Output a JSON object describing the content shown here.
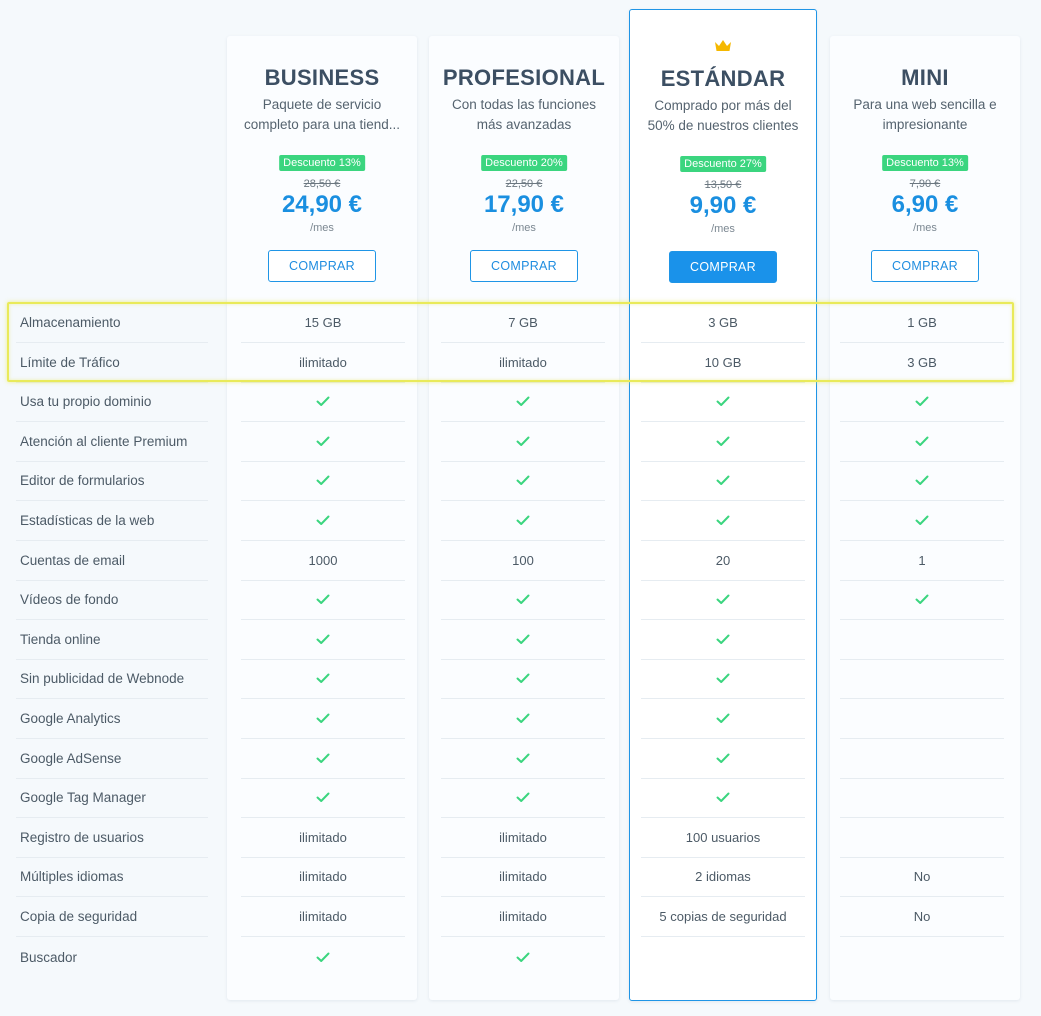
{
  "plans": [
    {
      "name": "BUSINESS",
      "desc": "Paquete de servicio completo para una tiend...",
      "discount": "Descuento 13%",
      "old_price": "28,50 €",
      "price": "24,90 €",
      "period": "/mes",
      "buy_label": "COMPRAR",
      "featured": false
    },
    {
      "name": "PROFESIONAL",
      "desc": "Con todas las funciones más avanzadas",
      "discount": "Descuento 20%",
      "old_price": "22,50 €",
      "price": "17,90 €",
      "period": "/mes",
      "buy_label": "COMPRAR",
      "featured": false
    },
    {
      "name": "ESTÁNDAR",
      "desc": "Comprado por más del 50% de nuestros clientes",
      "discount": "Descuento 27%",
      "old_price": "13,50 €",
      "price": "9,90 €",
      "period": "/mes",
      "buy_label": "COMPRAR",
      "featured": true
    },
    {
      "name": "MINI",
      "desc": "Para una web sencilla e impresionante",
      "discount": "Descuento 13%",
      "old_price": "7,90 €",
      "price": "6,90 €",
      "period": "/mes",
      "buy_label": "COMPRAR",
      "featured": false
    }
  ],
  "features": [
    {
      "label": "Almacenamiento",
      "values": [
        "15 GB",
        "7 GB",
        "3 GB",
        "1 GB"
      ]
    },
    {
      "label": "Límite de Tráfico",
      "values": [
        "ilimitado",
        "ilimitado",
        "10 GB",
        "3 GB"
      ]
    },
    {
      "label": "Usa tu propio dominio",
      "values": [
        "check",
        "check",
        "check",
        "check"
      ]
    },
    {
      "label": "Atención al cliente Premium",
      "values": [
        "check",
        "check",
        "check",
        "check"
      ]
    },
    {
      "label": "Editor de formularios",
      "values": [
        "check",
        "check",
        "check",
        "check"
      ]
    },
    {
      "label": "Estadísticas de la web",
      "values": [
        "check",
        "check",
        "check",
        "check"
      ]
    },
    {
      "label": "Cuentas de email",
      "values": [
        "1000",
        "100",
        "20",
        "1"
      ]
    },
    {
      "label": "Vídeos de fondo",
      "values": [
        "check",
        "check",
        "check",
        "check"
      ]
    },
    {
      "label": "Tienda online",
      "values": [
        "check",
        "check",
        "check",
        ""
      ]
    },
    {
      "label": "Sin publicidad de Webnode",
      "values": [
        "check",
        "check",
        "check",
        ""
      ]
    },
    {
      "label": "Google Analytics",
      "values": [
        "check",
        "check",
        "check",
        ""
      ]
    },
    {
      "label": "Google AdSense",
      "values": [
        "check",
        "check",
        "check",
        ""
      ]
    },
    {
      "label": "Google Tag Manager",
      "values": [
        "check",
        "check",
        "check",
        ""
      ]
    },
    {
      "label": "Registro de usuarios",
      "values": [
        "ilimitado",
        "ilimitado",
        "100 usuarios",
        ""
      ]
    },
    {
      "label": "Múltiples idiomas",
      "values": [
        "ilimitado",
        "ilimitado",
        "2 idiomas",
        "No"
      ]
    },
    {
      "label": "Copia de seguridad",
      "values": [
        "ilimitado",
        "ilimitado",
        "5 copias de seguridad",
        "No"
      ]
    },
    {
      "label": "Buscador",
      "values": [
        "check",
        "check",
        "",
        ""
      ]
    }
  ],
  "colors": {
    "accent": "#1a92ea",
    "discount": "#3bd57f",
    "check": "#3bd57f",
    "crown": "#f5b800",
    "highlight": "#e9ea5a"
  },
  "icons": {
    "featured": "crown-icon",
    "included": "check-icon"
  }
}
